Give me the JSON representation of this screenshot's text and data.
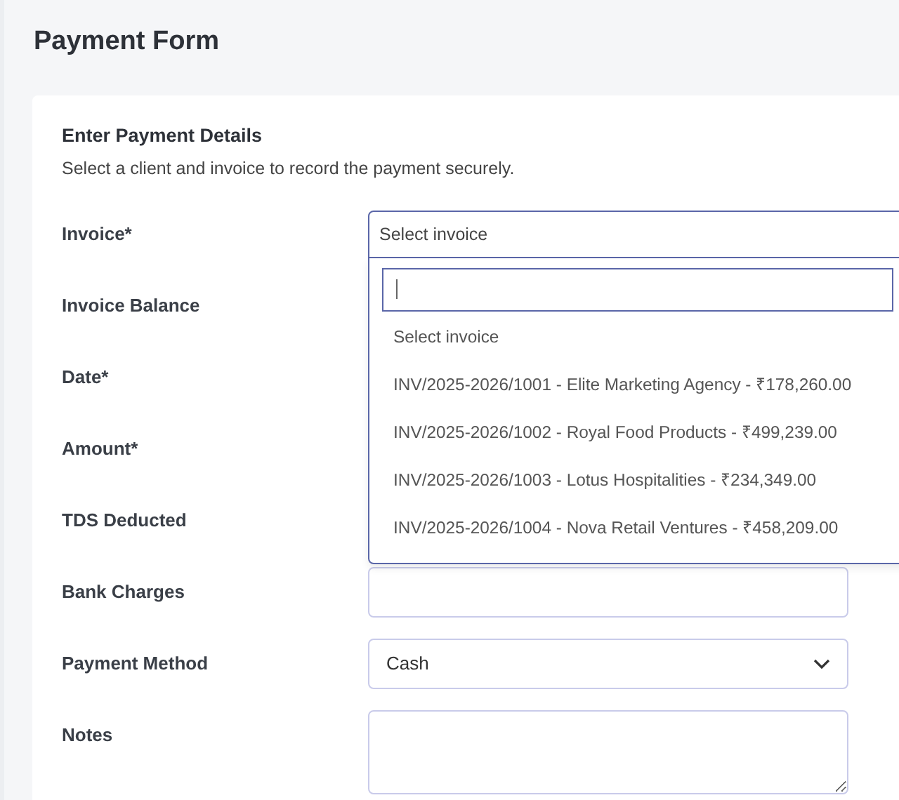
{
  "page": {
    "title": "Payment Form"
  },
  "card": {
    "heading": "Enter Payment Details",
    "subtitle": "Select a client and invoice to record the payment securely."
  },
  "fields": [
    {
      "label": "Invoice*",
      "kind": "dropdown",
      "value": "Select invoice",
      "expanded": true,
      "options": [
        "Select invoice",
        "INV/2025-2026/1001 - Elite Marketing Agency - ₹178,260.00",
        "INV/2025-2026/1002 - Royal Food Products - ₹499,239.00",
        "INV/2025-2026/1003 - Lotus Hospitalities - ₹234,349.00",
        "INV/2025-2026/1004 - Nova Retail Ventures - ₹458,209.00"
      ]
    },
    {
      "label": "Invoice Balance",
      "kind": "covered"
    },
    {
      "label": "Date*",
      "kind": "covered"
    },
    {
      "label": "Amount*",
      "kind": "covered"
    },
    {
      "label": "TDS Deducted",
      "kind": "covered"
    },
    {
      "label": "Bank Charges",
      "kind": "input"
    },
    {
      "label": "Payment Method",
      "kind": "select",
      "value": "Cash"
    },
    {
      "label": "Notes",
      "kind": "textarea"
    }
  ]
}
